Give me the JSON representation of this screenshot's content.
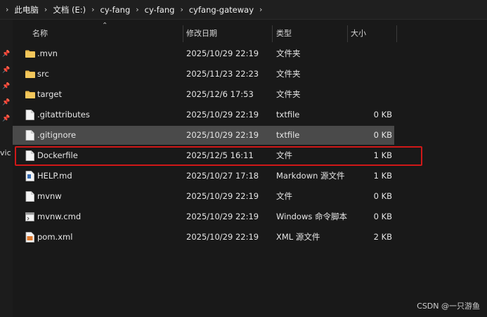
{
  "breadcrumb": [
    "此电脑",
    "文档 (E:)",
    "cy-fang",
    "cy-fang",
    "cyfang-gateway"
  ],
  "breadcrumb_separator": "›",
  "sidebar_cut_text": "vic",
  "columns": {
    "name": "名称",
    "date": "修改日期",
    "type": "类型",
    "size": "大小"
  },
  "files": [
    {
      "name": ".mvn",
      "date": "2025/10/29 22:19",
      "type": "文件夹",
      "size": "",
      "icon": "folder-icon"
    },
    {
      "name": "src",
      "date": "2025/11/23 22:23",
      "type": "文件夹",
      "size": "",
      "icon": "folder-icon"
    },
    {
      "name": "target",
      "date": "2025/12/6 17:53",
      "type": "文件夹",
      "size": "",
      "icon": "folder-icon"
    },
    {
      "name": ".gitattributes",
      "date": "2025/10/29 22:19",
      "type": "txtfile",
      "size": "0 KB",
      "icon": "file-icon"
    },
    {
      "name": ".gitignore",
      "date": "2025/10/29 22:19",
      "type": "txtfile",
      "size": "0 KB",
      "icon": "file-icon",
      "selected": true
    },
    {
      "name": "Dockerfile",
      "date": "2025/12/5 16:11",
      "type": "文件",
      "size": "1 KB",
      "icon": "file-icon",
      "highlighted": true
    },
    {
      "name": "HELP.md",
      "date": "2025/10/27 17:18",
      "type": "Markdown 源文件",
      "size": "1 KB",
      "icon": "markdown-file-icon"
    },
    {
      "name": "mvnw",
      "date": "2025/10/29 22:19",
      "type": "文件",
      "size": "0 KB",
      "icon": "file-icon"
    },
    {
      "name": "mvnw.cmd",
      "date": "2025/10/29 22:19",
      "type": "Windows 命令脚本",
      "size": "0 KB",
      "icon": "script-file-icon"
    },
    {
      "name": "pom.xml",
      "date": "2025/10/29 22:19",
      "type": "XML 源文件",
      "size": "2 KB",
      "icon": "xml-file-icon"
    }
  ],
  "watermark": "CSDN @一只游鱼",
  "colors": {
    "folder": "#e8b84a",
    "highlight_border": "#d01818",
    "selected_row": "#4a4a4a"
  }
}
